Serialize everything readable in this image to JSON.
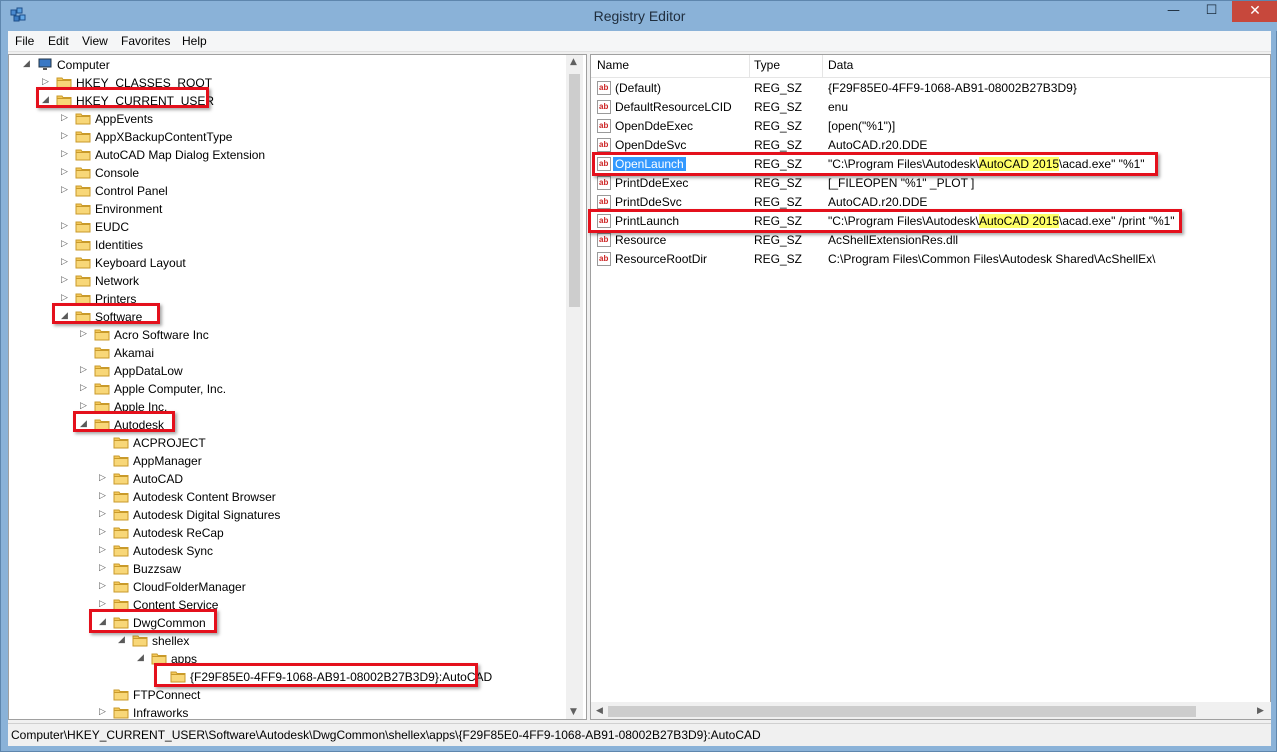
{
  "window": {
    "title": "Registry Editor",
    "min_glyph": "—",
    "max_glyph": "☐",
    "close_glyph": "✕"
  },
  "menu": [
    "File",
    "Edit",
    "View",
    "Favorites",
    "Help"
  ],
  "tree": [
    {
      "label": "Computer",
      "level": 0,
      "twisty": "◢",
      "icon": "computer-icon"
    },
    {
      "label": "HKEY_CLASSES_ROOT",
      "level": 1,
      "twisty": "▷"
    },
    {
      "label": "HKEY_CURRENT_USER",
      "level": 1,
      "twisty": "◢"
    },
    {
      "label": "AppEvents",
      "level": 2,
      "twisty": "▷"
    },
    {
      "label": "AppXBackupContentType",
      "level": 2,
      "twisty": "▷"
    },
    {
      "label": "AutoCAD Map Dialog Extension",
      "level": 2,
      "twisty": "▷"
    },
    {
      "label": "Console",
      "level": 2,
      "twisty": "▷"
    },
    {
      "label": "Control Panel",
      "level": 2,
      "twisty": "▷"
    },
    {
      "label": "Environment",
      "level": 2,
      "twisty": ""
    },
    {
      "label": "EUDC",
      "level": 2,
      "twisty": "▷"
    },
    {
      "label": "Identities",
      "level": 2,
      "twisty": "▷"
    },
    {
      "label": "Keyboard Layout",
      "level": 2,
      "twisty": "▷"
    },
    {
      "label": "Network",
      "level": 2,
      "twisty": "▷"
    },
    {
      "label": "Printers",
      "level": 2,
      "twisty": "▷"
    },
    {
      "label": "Software",
      "level": 2,
      "twisty": "◢"
    },
    {
      "label": "Acro Software Inc",
      "level": 3,
      "twisty": "▷"
    },
    {
      "label": "Akamai",
      "level": 3,
      "twisty": ""
    },
    {
      "label": "AppDataLow",
      "level": 3,
      "twisty": "▷"
    },
    {
      "label": "Apple Computer, Inc.",
      "level": 3,
      "twisty": "▷"
    },
    {
      "label": "Apple Inc.",
      "level": 3,
      "twisty": "▷"
    },
    {
      "label": "Autodesk",
      "level": 3,
      "twisty": "◢"
    },
    {
      "label": "ACPROJECT",
      "level": 4,
      "twisty": ""
    },
    {
      "label": "AppManager",
      "level": 4,
      "twisty": ""
    },
    {
      "label": "AutoCAD",
      "level": 4,
      "twisty": "▷"
    },
    {
      "label": "Autodesk Content Browser",
      "level": 4,
      "twisty": "▷"
    },
    {
      "label": "Autodesk Digital Signatures",
      "level": 4,
      "twisty": "▷"
    },
    {
      "label": "Autodesk ReCap",
      "level": 4,
      "twisty": "▷"
    },
    {
      "label": "Autodesk Sync",
      "level": 4,
      "twisty": "▷"
    },
    {
      "label": "Buzzsaw",
      "level": 4,
      "twisty": "▷"
    },
    {
      "label": "CloudFolderManager",
      "level": 4,
      "twisty": "▷"
    },
    {
      "label": "Content Service",
      "level": 4,
      "twisty": "▷"
    },
    {
      "label": "DwgCommon",
      "level": 4,
      "twisty": "◢"
    },
    {
      "label": "shellex",
      "level": 5,
      "twisty": "◢"
    },
    {
      "label": "apps",
      "level": 6,
      "twisty": "◢"
    },
    {
      "label": "{F29F85E0-4FF9-1068-AB91-08002B27B3D9}:AutoCAD",
      "level": 7,
      "twisty": ""
    },
    {
      "label": "FTPConnect",
      "level": 4,
      "twisty": ""
    },
    {
      "label": "Infraworks",
      "level": 4,
      "twisty": "▷"
    }
  ],
  "list": {
    "headers": {
      "name": "Name",
      "type": "Type",
      "data": "Data"
    },
    "rows": [
      {
        "name": "(Default)",
        "type": "REG_SZ",
        "data": "{F29F85E0-4FF9-1068-AB91-08002B27B3D9}"
      },
      {
        "name": "DefaultResourceLCID",
        "type": "REG_SZ",
        "data": "enu"
      },
      {
        "name": "OpenDdeExec",
        "type": "REG_SZ",
        "data": "[open(\"%1\")]"
      },
      {
        "name": "OpenDdeSvc",
        "type": "REG_SZ",
        "data": "AutoCAD.r20.DDE"
      },
      {
        "name": "OpenLaunch",
        "type": "REG_SZ",
        "data_pre": "\"C:\\Program Files\\Autodesk\\",
        "data_hl": "AutoCAD 2015",
        "data_post": "\\acad.exe\" \"%1\"",
        "selected": true
      },
      {
        "name": "PrintDdeExec",
        "type": "REG_SZ",
        "data": "[_FILEOPEN \"%1\" _PLOT ]"
      },
      {
        "name": "PrintDdeSvc",
        "type": "REG_SZ",
        "data": "AutoCAD.r20.DDE"
      },
      {
        "name": "PrintLaunch",
        "type": "REG_SZ",
        "data_pre": "\"C:\\Program Files\\Autodesk\\",
        "data_hl": "AutoCAD 2015",
        "data_post": "\\acad.exe\" /print \"%1\""
      },
      {
        "name": "Resource",
        "type": "REG_SZ",
        "data": "AcShellExtensionRes.dll"
      },
      {
        "name": "ResourceRootDir",
        "type": "REG_SZ",
        "data": "C:\\Program Files\\Common Files\\Autodesk Shared\\AcShellEx\\"
      }
    ]
  },
  "status": "Computer\\HKEY_CURRENT_USER\\Software\\Autodesk\\DwgCommon\\shellex\\apps\\{F29F85E0-4FF9-1068-AB91-08002B27B3D9}:AutoCAD",
  "icons": {
    "value_type": "ab",
    "app": "registry-editor-icon",
    "arrow_up": "▲",
    "arrow_down": "▼",
    "arrow_left": "◀",
    "arrow_right": "▶"
  },
  "colors": {
    "title_bg": "#8ab2d8",
    "selection": "#3399ff",
    "highlight": "#ffff66",
    "annotation_box": "#e4101c",
    "close_btn": "#c7483c"
  }
}
